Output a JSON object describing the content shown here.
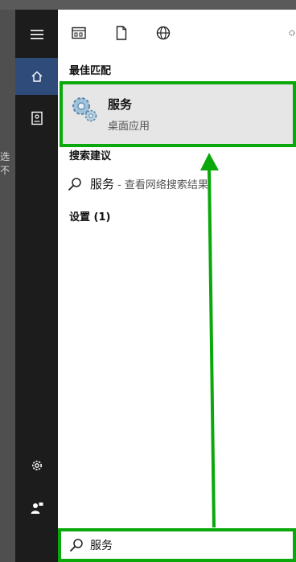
{
  "background": {
    "partial_text": "选不"
  },
  "toolbar": {
    "icons": [
      "apps-icon",
      "document-icon",
      "web-icon",
      "settings-icon"
    ]
  },
  "sections": {
    "best_match": "最佳匹配",
    "search_suggestions": "搜索建议",
    "settings": "设置 (1)"
  },
  "best_match_item": {
    "title": "服务",
    "subtitle": "桌面应用"
  },
  "suggestion": {
    "query": "服务",
    "description": "- 查看网络搜索结果"
  },
  "search": {
    "value": "服务"
  },
  "colors": {
    "highlight": "#0aa80a",
    "rail": "#1c1c1c",
    "active": "#2e4b7a"
  }
}
